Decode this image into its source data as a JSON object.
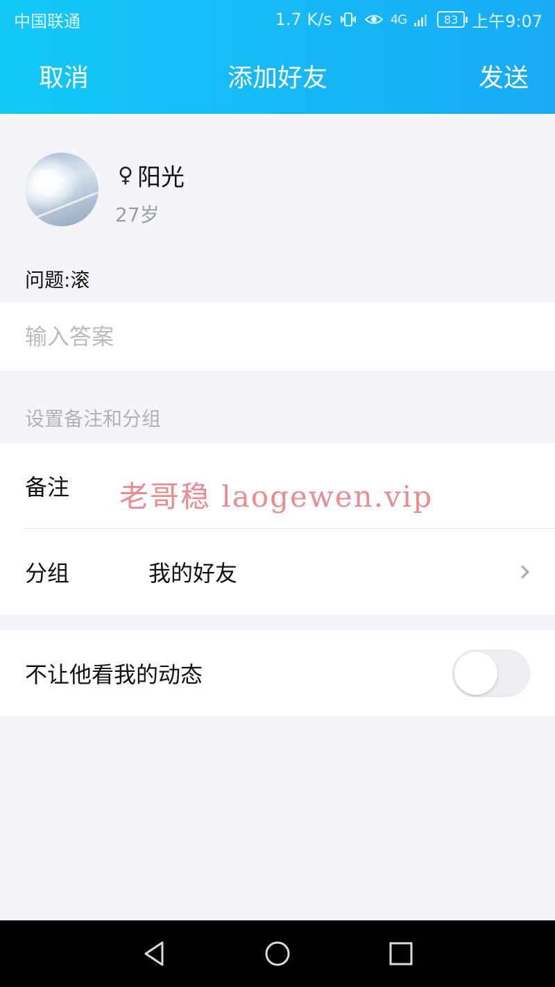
{
  "status_bar": {
    "carrier": "中国联通",
    "net_speed": "1.7 K/s",
    "network": "4G",
    "battery": "83",
    "time": "上午9:07"
  },
  "nav": {
    "cancel": "取消",
    "title": "添加好友",
    "send": "发送"
  },
  "profile": {
    "gender_symbol": "♀",
    "name": "阳光",
    "age": "27岁",
    "question": "问题:滚"
  },
  "answer": {
    "placeholder": "输入答案",
    "value": ""
  },
  "section_label": "设置备注和分组",
  "remark": {
    "label": "备注",
    "watermark": "老哥稳 laogewen.vip"
  },
  "group": {
    "label": "分组",
    "value": "我的好友"
  },
  "privacy": {
    "label": "不让他看我的动态",
    "enabled": false
  },
  "colors": {
    "header_start": "#12c8f5",
    "header_end": "#19aaf6",
    "background": "#f4f5f9",
    "watermark": "#ec8a8f"
  },
  "icons": [
    "vibrate-icon",
    "eye-icon",
    "signal-icon",
    "battery-icon",
    "back-icon",
    "home-icon",
    "recent-apps-icon",
    "chevron-right-icon"
  ]
}
